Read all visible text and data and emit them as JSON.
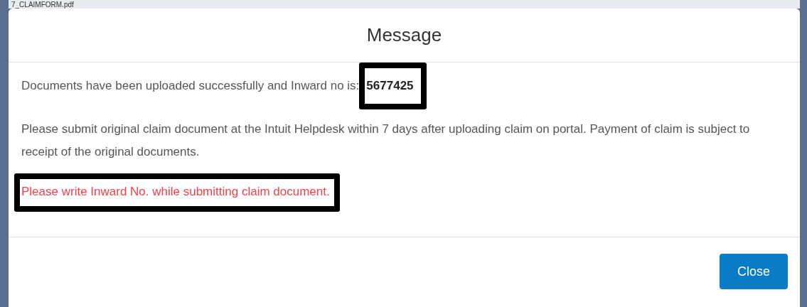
{
  "background": {
    "file_name": "7_CLAIMFORM.pdf"
  },
  "dialog": {
    "title": "Message",
    "message": "Documents have been uploaded successfully and Inward no is:",
    "inward_no": "5677425",
    "instructions": "Please submit original claim document at the Intuit Helpdesk within 7 days after uploading claim on portal. Payment of claim is subject to receipt of the original documents.",
    "notice": "Please write Inward No. while submitting claim document.",
    "buttons": [
      "Close"
    ]
  }
}
